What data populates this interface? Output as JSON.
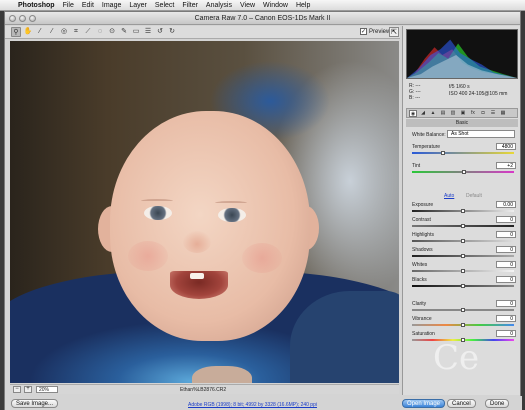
{
  "menubar": {
    "app": "Photoshop",
    "items": [
      "File",
      "Edit",
      "Image",
      "Layer",
      "Select",
      "Filter",
      "Analysis",
      "View",
      "Window",
      "Help"
    ]
  },
  "window": {
    "title": "Camera Raw 7.0  –  Canon EOS-1Ds Mark II"
  },
  "toolbar": {
    "tools": [
      "zoom-icon",
      "hand-icon",
      "white-balance-icon",
      "color-sampler-icon",
      "target-adjust-icon",
      "crop-icon",
      "straighten-icon",
      "spot-removal-icon",
      "red-eye-icon",
      "adjustment-brush-icon",
      "graduated-filter-icon",
      "preferences-icon",
      "rotate-left-icon",
      "rotate-right-icon"
    ],
    "preview_label": "Preview",
    "preview_checked": true
  },
  "status": {
    "zoom_minus": "−",
    "zoom_plus": "+",
    "zoom_value": "20%",
    "filename": "Ethan%LB2876.CR2"
  },
  "info": {
    "r": "R:  ---",
    "g": "G:  ---",
    "b": "B:  ---",
    "line1": "f/5    1/60 s",
    "line2": "ISO 400   24-105@105 mm"
  },
  "histogram": {
    "colors": [
      "#ff3030",
      "#30ff30",
      "#3060ff",
      "#ffffff"
    ]
  },
  "panel": {
    "tabs": [
      "basic-icon",
      "tone-curve-icon",
      "detail-icon",
      "hsl-icon",
      "split-toning-icon",
      "lens-icon",
      "effects-icon",
      "camera-calibration-icon",
      "presets-icon",
      "snapshots-icon"
    ],
    "title": "Basic",
    "white_balance_label": "White Balance:",
    "white_balance_value": "As Shot",
    "temperature": {
      "label": "Temperature",
      "value": "4800",
      "level": 0.3
    },
    "tint": {
      "label": "Tint",
      "value": "+2",
      "level": 0.51
    },
    "auto_label": "Auto",
    "default_label": "Default",
    "exposure": {
      "label": "Exposure",
      "value": "0.00",
      "level": 0.5
    },
    "contrast": {
      "label": "Contrast",
      "value": "0",
      "level": 0.5
    },
    "highlights": {
      "label": "Highlights",
      "value": "0",
      "level": 0.5
    },
    "shadows": {
      "label": "Shadows",
      "value": "0",
      "level": 0.5
    },
    "whites": {
      "label": "Whites",
      "value": "0",
      "level": 0.5
    },
    "blacks": {
      "label": "Blacks",
      "value": "0",
      "level": 0.5
    },
    "clarity": {
      "label": "Clarity",
      "value": "0",
      "level": 0.5
    },
    "vibrance": {
      "label": "Vibrance",
      "value": "0",
      "level": 0.5
    },
    "saturation": {
      "label": "Saturation",
      "value": "0",
      "level": 0.5
    }
  },
  "footer": {
    "save_label": "Save Image...",
    "workflow_link": "Adobe RGB (1998); 8 bit; 4992 by 3328 (16.6MP); 240 ppi",
    "open_label": "Open Image",
    "cancel_label": "Cancel",
    "done_label": "Done"
  },
  "watermark": "Ce"
}
